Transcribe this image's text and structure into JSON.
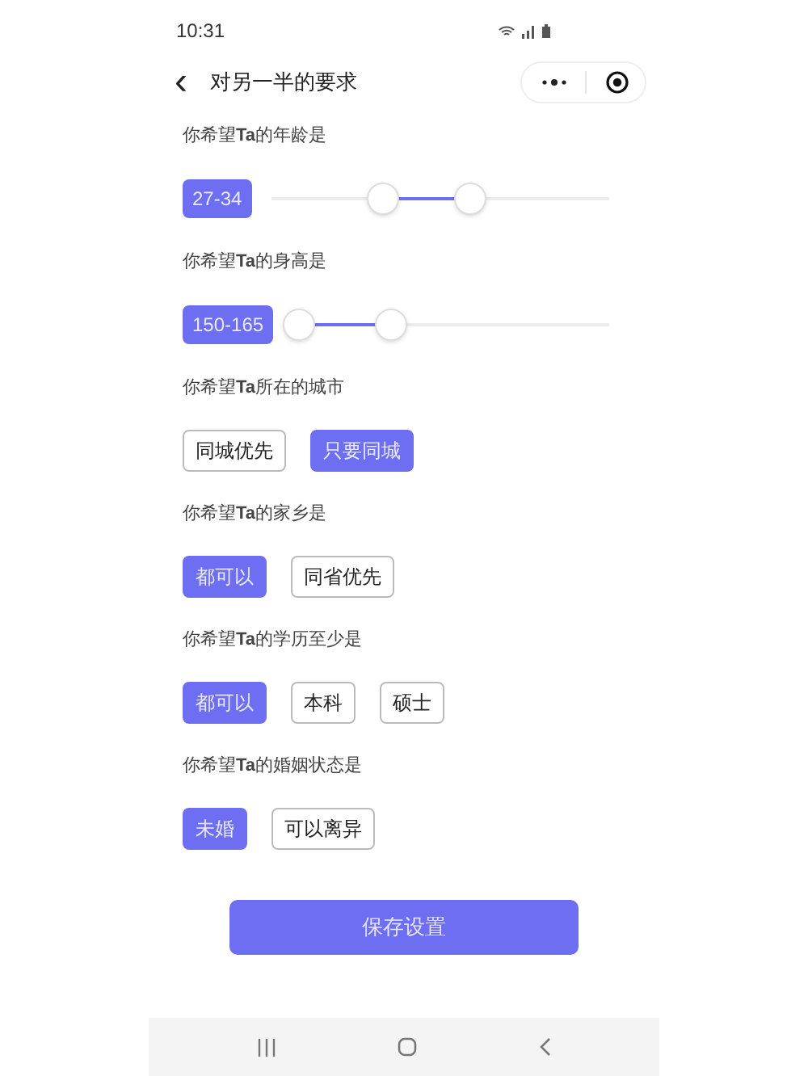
{
  "status_bar": {
    "time": "10:31"
  },
  "header": {
    "back": "‹",
    "title": "对另一半的要求"
  },
  "sections": [
    {
      "kind": "slider",
      "label": "你希望**Ta**的年龄是",
      "reading": "27-34",
      "thumbs": [
        {
          "level": 0.33
        },
        {
          "level": 0.59
        }
      ]
    },
    {
      "kind": "slider",
      "label": "你希望**Ta**的身高是",
      "reading": "150-165",
      "thumbs": [
        {
          "level": 0.02
        },
        {
          "level": 0.31
        }
      ]
    },
    {
      "kind": "options",
      "label": "你希望**Ta**所在的城市",
      "options": [
        {
          "label": "同城优先",
          "selected": false
        },
        {
          "label": "只要同城",
          "selected": true
        }
      ]
    },
    {
      "kind": "options",
      "label": "你希望**Ta**的家乡是",
      "options": [
        {
          "label": "都可以",
          "selected": true
        },
        {
          "label": "同省优先",
          "selected": false
        }
      ]
    },
    {
      "kind": "options",
      "label": "你希望**Ta**的学历至少是",
      "options": [
        {
          "label": "都可以",
          "selected": true
        },
        {
          "label": "本科",
          "selected": false
        },
        {
          "label": "硕士",
          "selected": false
        }
      ]
    },
    {
      "kind": "options",
      "label": "你希望**Ta**的婚姻状态是",
      "options": [
        {
          "label": "未婚",
          "selected": true
        },
        {
          "label": "可以离异",
          "selected": false
        }
      ]
    }
  ],
  "save_button": "保存设置"
}
